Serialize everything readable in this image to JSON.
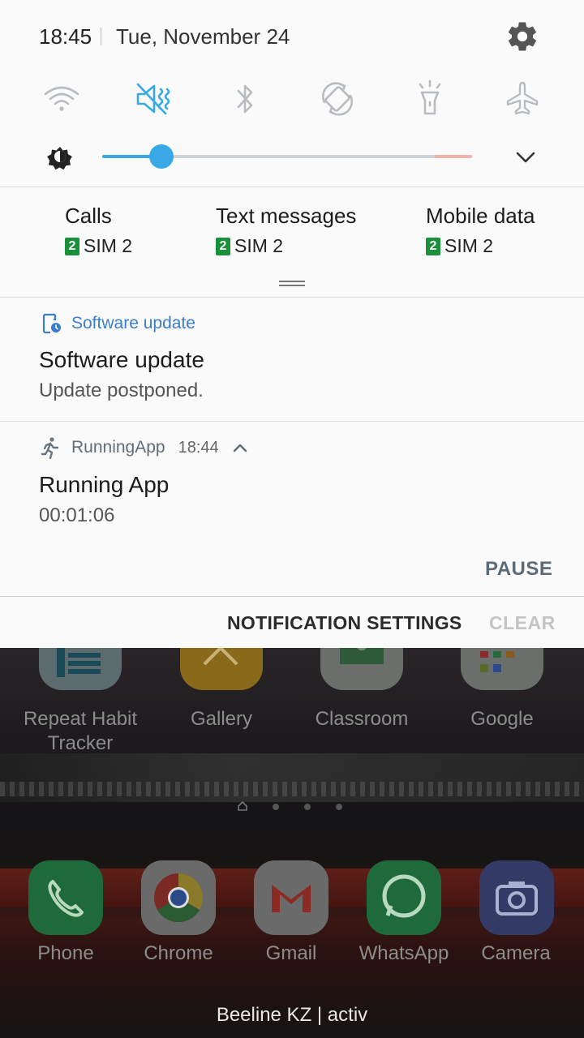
{
  "status_bar": {
    "time": "18:45",
    "date": "Tue, November 24"
  },
  "quick_settings": [
    {
      "name": "wifi",
      "active": false
    },
    {
      "name": "sound-mute-vibrate",
      "active": true
    },
    {
      "name": "bluetooth",
      "active": false
    },
    {
      "name": "auto-rotate",
      "active": false
    },
    {
      "name": "flashlight",
      "active": false
    },
    {
      "name": "airplane-mode",
      "active": false
    }
  ],
  "brightness": {
    "level": 0.16
  },
  "sim": [
    {
      "label": "Calls",
      "badge": "2",
      "sim": "SIM 2"
    },
    {
      "label": "Text messages",
      "badge": "2",
      "sim": "SIM 2"
    },
    {
      "label": "Mobile data",
      "badge": "2",
      "sim": "SIM 2"
    }
  ],
  "notifications": {
    "software": {
      "app": "Software update",
      "title": "Software update",
      "text": "Update postponed."
    },
    "running": {
      "app": "RunningApp",
      "time": "18:44",
      "title": "Running App",
      "text": "00:01:06",
      "action": "PAUSE"
    }
  },
  "footer": {
    "settings": "NOTIFICATION SETTINGS",
    "clear": "CLEAR"
  },
  "home": {
    "apps": [
      "Repeat Habit\nTracker",
      "Gallery",
      "Classroom",
      "Google"
    ],
    "app_line1": [
      "Repeat Habit",
      "Gallery",
      "Classroom",
      "Google"
    ],
    "app_line2": [
      "Tracker",
      "",
      "",
      ""
    ],
    "dock": [
      "Phone",
      "Chrome",
      "Gmail",
      "WhatsApp",
      "Camera"
    ],
    "carrier": "Beeline KZ | activ"
  },
  "colors": {
    "accent": "#39a9e6",
    "sim_badge": "#1a8f3c",
    "pause": "#5b6b78"
  }
}
